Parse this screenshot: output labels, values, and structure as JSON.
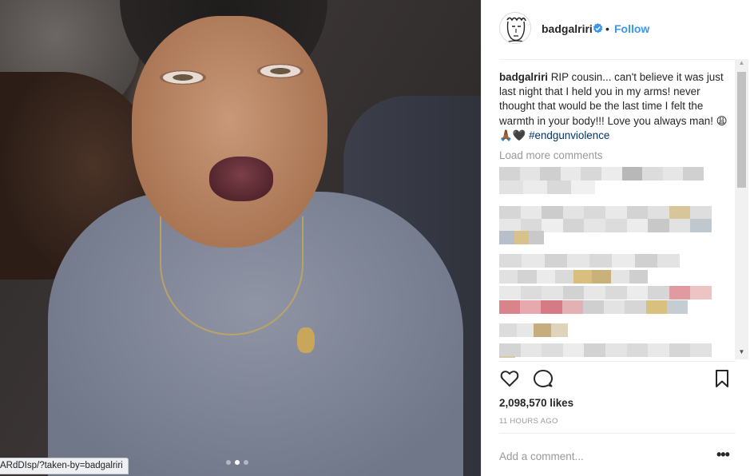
{
  "post": {
    "username": "badgalriri",
    "verified": true,
    "separator": "•",
    "follow_label": "Follow",
    "caption_username": "badgalriri",
    "caption_text": " RIP cousin... can't believe it was just last night that I held you in my arms! never thought that would be the last time I felt the warmth in your body!!! Love you always man! 😩🙏🏾🖤 ",
    "caption_hashtag": "#endgunviolence",
    "load_more": "Load more comments",
    "likes": "2,098,570 likes",
    "time": "11 HOURS AGO",
    "comment_placeholder": "Add a comment...",
    "more_label": "•••"
  },
  "status_bar": {
    "url_text": "ARdDIsp/?taken-by=badgalriri"
  },
  "carousel": {
    "count": 3,
    "active_index": 1
  },
  "colors": {
    "follow_blue": "#3897f0",
    "verified_blue": "#3897f0",
    "hashtag": "#003569",
    "muted": "#999999"
  },
  "icons": {
    "like": "heart-icon",
    "comment": "speech-bubble-icon",
    "save": "bookmark-icon",
    "verified": "verified-badge-icon",
    "more": "ellipsis-icon"
  }
}
